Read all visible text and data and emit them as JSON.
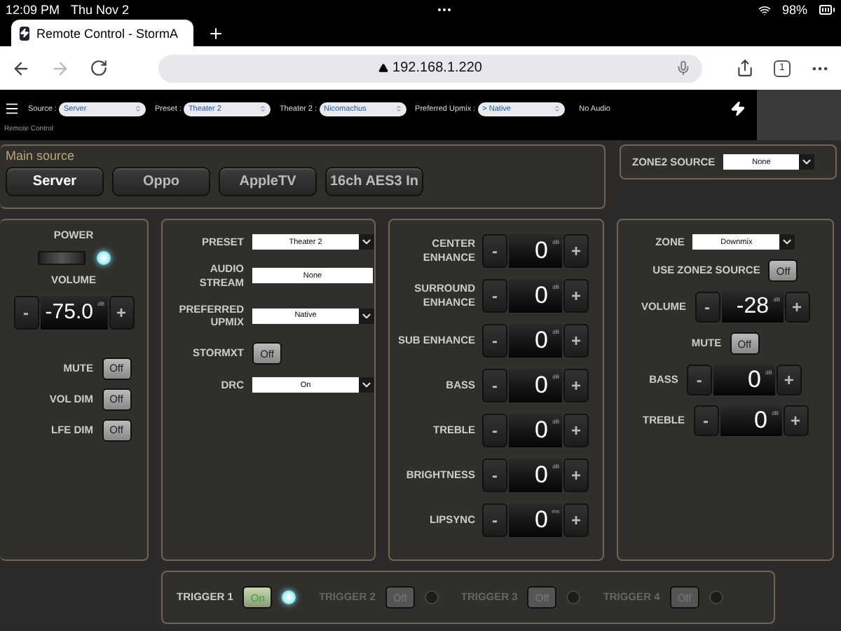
{
  "status_bar": {
    "time": "12:09 PM",
    "date": "Thu Nov 2",
    "battery": "98%"
  },
  "browser": {
    "tab_title": "Remote Control - StormA",
    "url": "192.168.1.220",
    "tab_count": "1"
  },
  "header": {
    "selects": [
      {
        "label": "Source :",
        "value": "Server"
      },
      {
        "label": "Preset :",
        "value": "Theater 2"
      },
      {
        "label": "Theater 2 :",
        "value": "Nicomachus"
      },
      {
        "label": "Preferred Upmix :",
        "value": "> Native"
      }
    ],
    "status": "No Audio",
    "subtitle": "Remote Control"
  },
  "main_source": {
    "title": "Main source",
    "buttons": [
      {
        "label": "Server",
        "selected": true
      },
      {
        "label": "Oppo",
        "selected": false
      },
      {
        "label": "AppleTV",
        "selected": false
      },
      {
        "label": "16ch AES3 In",
        "selected": false
      }
    ]
  },
  "zone2_source": {
    "label": "ZONE2 SOURCE",
    "value": "None"
  },
  "power_panel": {
    "power": {
      "label": "POWER",
      "on": true
    },
    "volume": {
      "label": "VOLUME",
      "value": "-75.0",
      "unit": "dB",
      "minus": "-",
      "plus": "+"
    },
    "toggles": [
      {
        "label": "MUTE",
        "value": "Off",
        "on": false
      },
      {
        "label": "VOL DIM",
        "value": "Off",
        "on": false
      },
      {
        "label": "LFE DIM",
        "value": "Off",
        "on": false
      }
    ]
  },
  "settings_panel": {
    "rows": [
      {
        "kind": "select",
        "label": "PRESET",
        "value": "Theater 2"
      },
      {
        "kind": "field",
        "label": "AUDIO STREAM",
        "value": "None"
      },
      {
        "kind": "select",
        "label": "PREFERRED UPMIX",
        "value": "Native"
      },
      {
        "kind": "toggle",
        "label": "STORMXT",
        "value": "Off",
        "on": false
      },
      {
        "kind": "select",
        "label": "DRC",
        "value": "On"
      }
    ]
  },
  "adjust_panel": {
    "steppers": [
      {
        "label": "CENTER ENHANCE",
        "value": "0",
        "unit": "dB",
        "minus": "-",
        "plus": "+"
      },
      {
        "label": "SURROUND ENHANCE",
        "value": "0",
        "unit": "dB",
        "minus": "-",
        "plus": "+"
      },
      {
        "label": "SUB ENHANCE",
        "value": "0",
        "unit": "dB",
        "minus": "-",
        "plus": "+"
      },
      {
        "label": "BASS",
        "value": "0",
        "unit": "dB",
        "minus": "-",
        "plus": "+"
      },
      {
        "label": "TREBLE",
        "value": "0",
        "unit": "dB",
        "minus": "-",
        "plus": "+"
      },
      {
        "label": "BRIGHTNESS",
        "value": "0",
        "unit": "dB",
        "minus": "-",
        "plus": "+"
      },
      {
        "label": "LIPSYNC",
        "value": "0",
        "unit": "ms",
        "minus": "-",
        "plus": "+"
      }
    ]
  },
  "zone_panel": {
    "rows": [
      {
        "kind": "select",
        "label": "ZONE",
        "value": "Downmix"
      },
      {
        "kind": "toggle",
        "label": "USE ZONE2 SOURCE",
        "value": "Off",
        "on": false
      },
      {
        "kind": "stepper",
        "label": "VOLUME",
        "value": "-28",
        "unit": "dB",
        "minus": "-",
        "plus": "+"
      },
      {
        "kind": "toggle",
        "label": "MUTE",
        "value": "Off",
        "on": false
      },
      {
        "kind": "stepper",
        "label": "BASS",
        "value": "0",
        "unit": "dB",
        "minus": "-",
        "plus": "+"
      },
      {
        "kind": "stepper",
        "label": "TREBLE",
        "value": "0",
        "unit": "dB",
        "minus": "-",
        "plus": "+"
      }
    ]
  },
  "triggers": [
    {
      "label": "TRIGGER 1",
      "value": "On",
      "on": true,
      "disabled": false
    },
    {
      "label": "TRIGGER 2",
      "value": "Off",
      "on": false,
      "disabled": true
    },
    {
      "label": "TRIGGER 3",
      "value": "Off",
      "on": false,
      "disabled": true
    },
    {
      "label": "TRIGGER 4",
      "value": "Off",
      "on": false,
      "disabled": true
    }
  ]
}
